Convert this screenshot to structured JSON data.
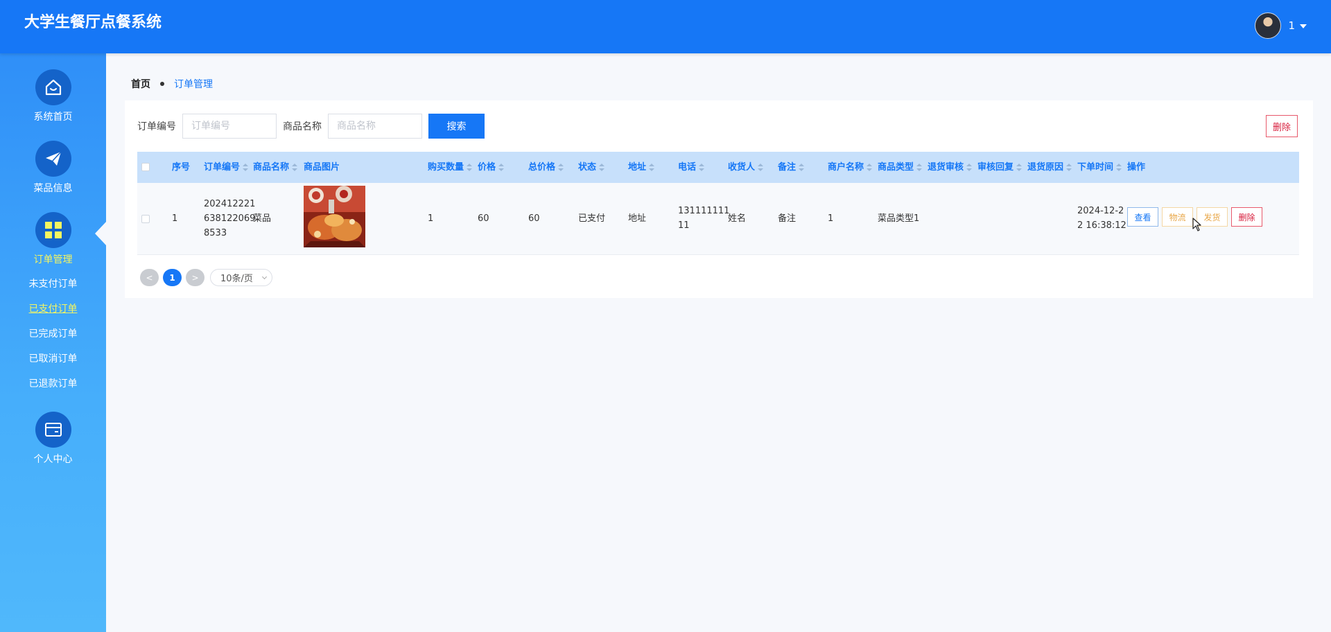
{
  "header": {
    "app_title": "大学生餐厅点餐系统",
    "user_name": "1"
  },
  "sidebar": {
    "items": [
      {
        "label": "系统首页",
        "icon": "home-icon"
      },
      {
        "label": "菜品信息",
        "icon": "paper-plane-icon"
      },
      {
        "label": "订单管理",
        "icon": "grid-icon"
      },
      {
        "label": "个人中心",
        "icon": "wallet-icon"
      }
    ],
    "sub_items": [
      "未支付订单",
      "已支付订单",
      "已完成订单",
      "已取消订单",
      "已退款订单"
    ],
    "active_item": "订单管理",
    "active_sub_item": "已支付订单"
  },
  "breadcrumb": {
    "home": "首页",
    "current": "订单管理"
  },
  "search": {
    "order_no_label": "订单编号",
    "order_no_placeholder": "订单编号",
    "product_name_label": "商品名称",
    "product_name_placeholder": "商品名称",
    "search_button": "搜索",
    "delete_button": "删除"
  },
  "table": {
    "columns": [
      "序号",
      "订单编号",
      "商品名称",
      "商品图片",
      "购买数量",
      "价格",
      "总价格",
      "状态",
      "地址",
      "电话",
      "收货人",
      "备注",
      "商户名称",
      "商品类型",
      "退货审核",
      "审核回复",
      "退货原因",
      "下单时间",
      "操作"
    ],
    "rows": [
      {
        "index": "1",
        "order_no_lines": [
          "202412221",
          "638122069",
          "8533"
        ],
        "product_name": "菜品",
        "quantity": "1",
        "price": "60",
        "total_price": "60",
        "status": "已支付",
        "address": "地址",
        "phone_lines": [
          "131111111",
          "11"
        ],
        "consignee": "姓名",
        "remark": "备注",
        "merchant": "1",
        "product_type": "菜品类型1",
        "return_review": "",
        "review_reply": "",
        "return_reason": "",
        "order_time_lines": [
          "2024-12-2",
          "2 16:38:12"
        ]
      }
    ],
    "actions": {
      "view": "查看",
      "logistics": "物流",
      "ship": "发货",
      "delete": "删除"
    }
  },
  "pagination": {
    "prev": "<",
    "current_page": "1",
    "next": ">",
    "page_size": "10条/页"
  },
  "colors": {
    "primary": "#1677f6",
    "header_bg": "#1677f6",
    "active_nav": "#f5f560",
    "danger": "#d8203e",
    "warning": "#e8a748",
    "table_header_bg": "#c7e0fb"
  }
}
